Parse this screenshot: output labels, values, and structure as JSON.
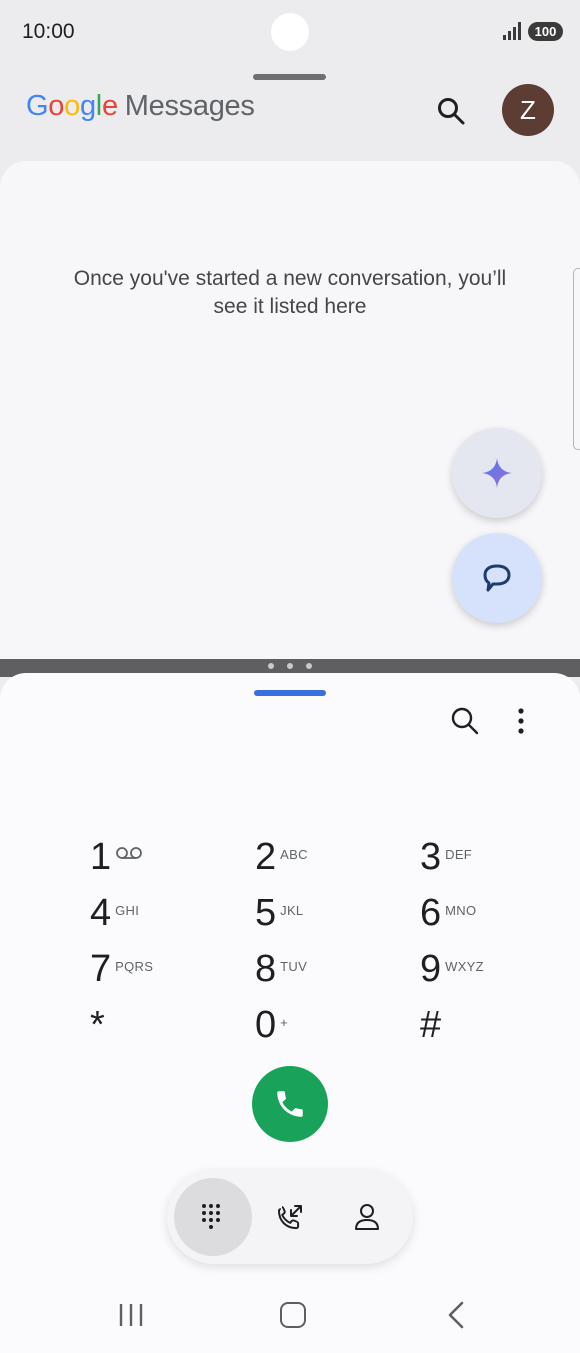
{
  "status_bar": {
    "time": "10:00",
    "battery": "100",
    "icons": [
      "signal-icon",
      "battery-icon"
    ]
  },
  "messages_app": {
    "title_google": [
      "G",
      "o",
      "o",
      "g",
      "l",
      "e"
    ],
    "title_messages": "Messages",
    "search_icon": "search-icon",
    "avatar_letter": "Z",
    "empty_state": "Once you've started a new conversation, you’ll see it listed here",
    "fab_gemini_icon": "sparkle-icon",
    "fab_start_chat_icon": "chat-bubble-icon",
    "colors": {
      "google_blue": "#4285F4",
      "google_red": "#EA4335",
      "google_yellow": "#FBBC05",
      "google_green": "#34A853",
      "avatar_bg": "#5d3c34"
    }
  },
  "phone_app": {
    "toolbar_icons": [
      "search-icon",
      "more-vert-icon"
    ],
    "keypad": [
      {
        "digit": "1",
        "letters": "",
        "icon": "voicemail-icon"
      },
      {
        "digit": "2",
        "letters": "ABC"
      },
      {
        "digit": "3",
        "letters": "DEF"
      },
      {
        "digit": "4",
        "letters": "GHI"
      },
      {
        "digit": "5",
        "letters": "JKL"
      },
      {
        "digit": "6",
        "letters": "MNO"
      },
      {
        "digit": "7",
        "letters": "PQRS"
      },
      {
        "digit": "8",
        "letters": "TUV"
      },
      {
        "digit": "9",
        "letters": "WXYZ"
      },
      {
        "digit": "*",
        "letters": ""
      },
      {
        "digit": "0",
        "letters": "+"
      },
      {
        "digit": "#",
        "letters": ""
      }
    ],
    "call_button_icon": "phone-icon",
    "call_button_color": "#19a35a",
    "bottom_tabs": [
      {
        "icon": "dialpad-icon",
        "active": true
      },
      {
        "icon": "recents-icon",
        "active": false
      },
      {
        "icon": "contacts-icon",
        "active": false
      }
    ]
  },
  "nav_bar": {
    "icons": [
      "recent-apps-icon",
      "home-icon",
      "back-icon"
    ]
  }
}
